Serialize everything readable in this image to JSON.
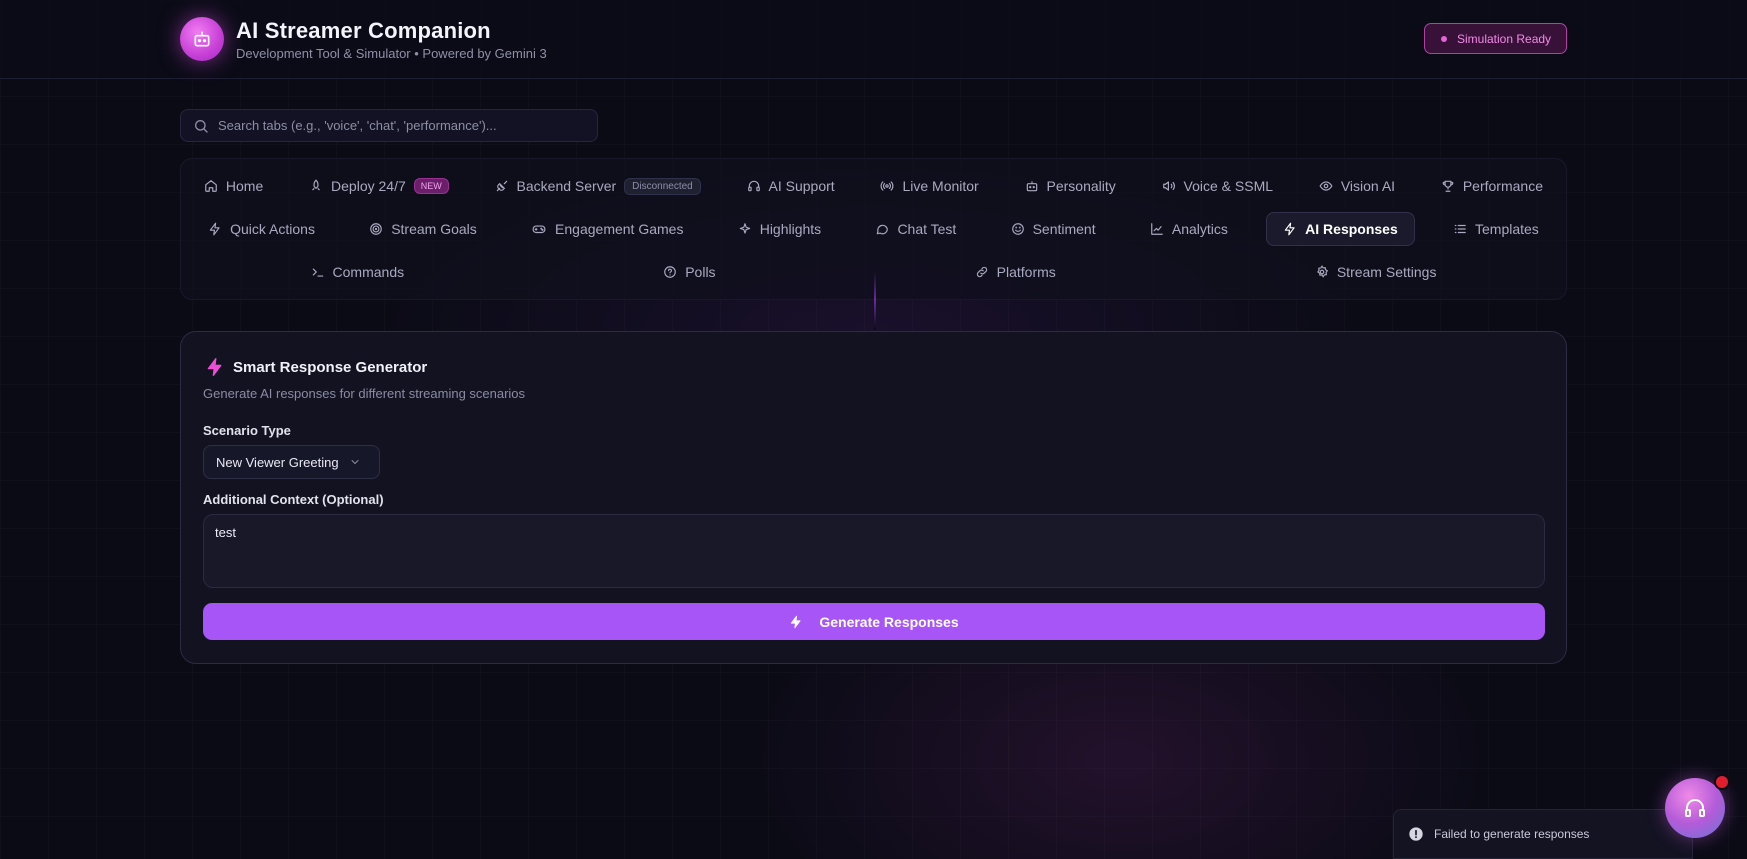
{
  "app": {
    "title": "AI Streamer Companion",
    "subtitle": "Development Tool & Simulator • Powered by Gemini 3",
    "status": "Simulation Ready"
  },
  "search": {
    "placeholder": "Search tabs (e.g., 'voice', 'chat', 'performance')..."
  },
  "tabs": {
    "row1": [
      {
        "label": "Home",
        "icon": "home-icon"
      },
      {
        "label": "Deploy 24/7",
        "icon": "rocket-icon",
        "badge": "NEW"
      },
      {
        "label": "Backend Server",
        "icon": "plug-icon",
        "badge": "Disconnected"
      },
      {
        "label": "AI Support",
        "icon": "headset-icon"
      },
      {
        "label": "Live Monitor",
        "icon": "broadcast-icon"
      },
      {
        "label": "Personality",
        "icon": "bot-icon"
      },
      {
        "label": "Voice & SSML",
        "icon": "speaker-icon"
      },
      {
        "label": "Vision AI",
        "icon": "eye-icon"
      },
      {
        "label": "Performance",
        "icon": "trophy-icon"
      }
    ],
    "row2": [
      {
        "label": "Quick Actions",
        "icon": "zap-icon"
      },
      {
        "label": "Stream Goals",
        "icon": "target-icon"
      },
      {
        "label": "Engagement Games",
        "icon": "gamepad-icon"
      },
      {
        "label": "Highlights",
        "icon": "sparkles-icon"
      },
      {
        "label": "Chat Test",
        "icon": "message-icon"
      },
      {
        "label": "Sentiment",
        "icon": "smile-icon"
      },
      {
        "label": "Analytics",
        "icon": "chart-line-icon"
      },
      {
        "label": "AI Responses",
        "icon": "zap-icon",
        "active": true
      },
      {
        "label": "Templates",
        "icon": "list-icon"
      }
    ],
    "row3": [
      {
        "label": "Commands",
        "icon": "terminal-icon"
      },
      {
        "label": "Polls",
        "icon": "help-circle-icon"
      },
      {
        "label": "Platforms",
        "icon": "link-icon"
      },
      {
        "label": "Stream Settings",
        "icon": "settings-icon"
      }
    ]
  },
  "generator": {
    "title": "Smart Response Generator",
    "description": "Generate AI responses for different streaming scenarios",
    "scenario_label": "Scenario Type",
    "scenario_value": "New Viewer Greeting",
    "context_label": "Additional Context (Optional)",
    "context_value": "test",
    "button_label": "Generate Responses"
  },
  "toast": {
    "message": "Failed to generate responses"
  },
  "colors": {
    "accent": "#a855f7",
    "status": "#e565d8",
    "background": "#0b0b16"
  }
}
